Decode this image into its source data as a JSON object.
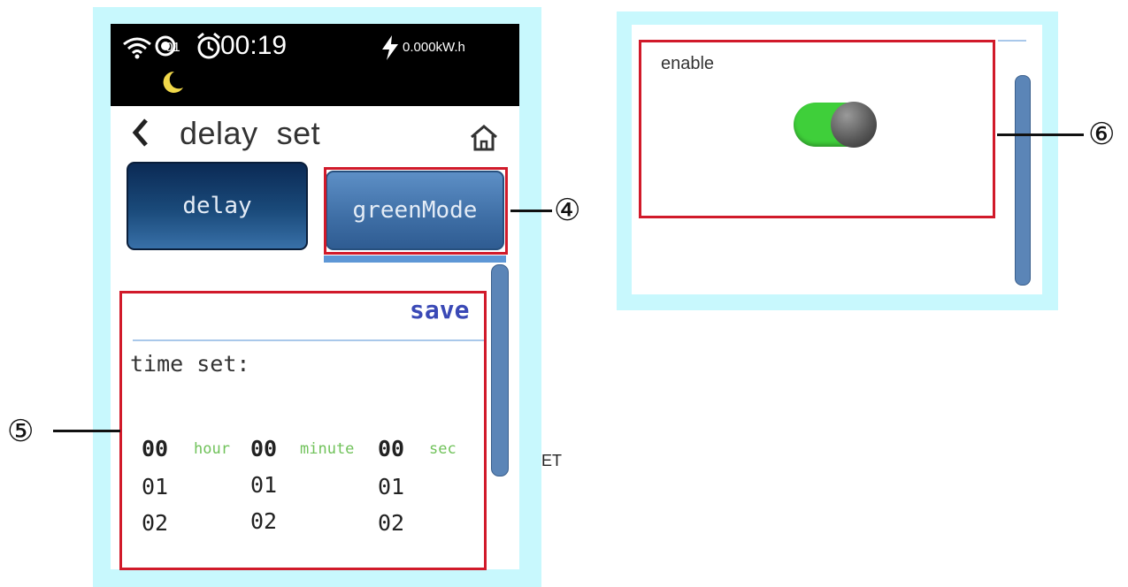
{
  "status_bar": {
    "timer_count": "01",
    "time": "00:19",
    "energy": "0.000kW.h"
  },
  "header": {
    "title": "delay  set"
  },
  "tabs": [
    {
      "label": "delay"
    },
    {
      "label": "greenMode"
    }
  ],
  "delay_panel": {
    "save_label": "save",
    "time_label": "time set:",
    "units": {
      "hour": "hour",
      "minute": "minute",
      "sec": "sec"
    },
    "hour_values": [
      "00",
      "01",
      "02"
    ],
    "minute_values": [
      "00",
      "01",
      "02"
    ],
    "second_values": [
      "00",
      "01",
      "02"
    ]
  },
  "green_mode_panel": {
    "enable_label": "enable",
    "enabled": true
  },
  "callouts": {
    "four": "④",
    "five": "⑤",
    "six": "⑥"
  },
  "stray_text": "ET",
  "colors": {
    "device_frame": "#c8f8fd",
    "highlight_box": "#d11a2a",
    "toggle_on": "#3fcf3a",
    "save_link": "#3a49b6",
    "unit_text": "#70c25a"
  }
}
